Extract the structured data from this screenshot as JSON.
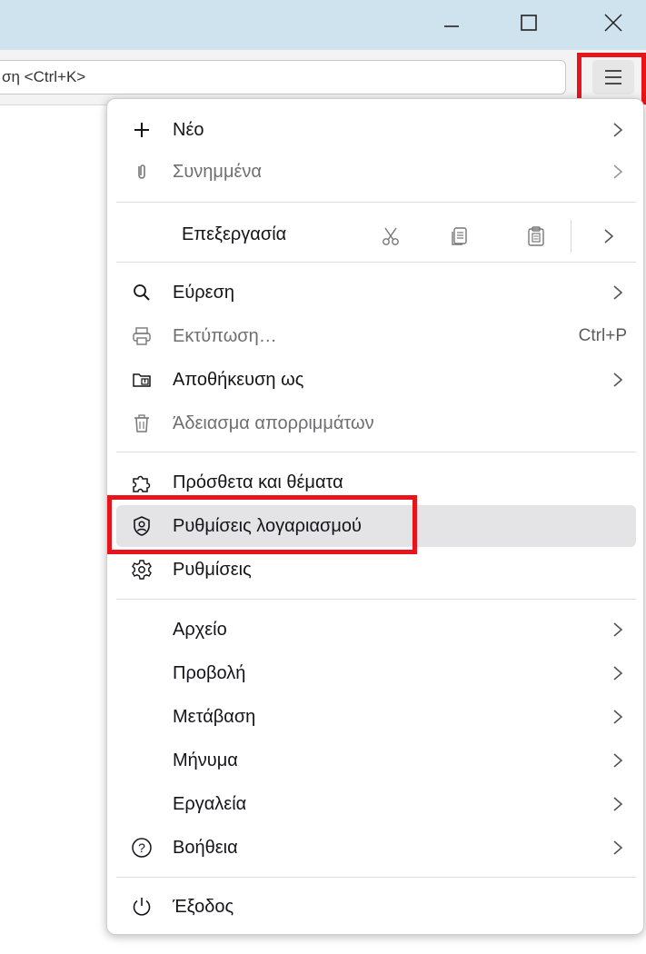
{
  "window": {
    "minimize_icon": "minimize-icon",
    "maximize_icon": "maximize-icon",
    "close_icon": "close-icon"
  },
  "search": {
    "placeholder_visible": "ση <Ctrl+K>"
  },
  "app_menu": {
    "button_icon": "hamburger-icon",
    "items_top": [
      {
        "label": "Νέο",
        "icon": "plus-icon",
        "submenu": true,
        "disabled": false
      },
      {
        "label": "Συνημμένα",
        "icon": "paperclip-icon",
        "submenu": true,
        "disabled": true
      }
    ],
    "edit": {
      "label": "Επεξεργασία",
      "cut_icon": "scissors-icon",
      "copy_icon": "copy-icon",
      "paste_icon": "paste-icon"
    },
    "items_mid": [
      {
        "label": "Εύρεση",
        "icon": "search-icon",
        "submenu": true,
        "disabled": false
      },
      {
        "label": "Εκτύπωση…",
        "icon": "printer-icon",
        "shortcut": "Ctrl+P",
        "disabled": true
      },
      {
        "label": "Αποθήκευση ως",
        "icon": "save-folder-icon",
        "submenu": true,
        "disabled": false
      },
      {
        "label": "Άδειασμα απορριμμάτων",
        "icon": "trash-icon",
        "disabled": true
      }
    ],
    "items_settings": [
      {
        "label": "Πρόσθετα και θέματα",
        "icon": "puzzle-icon"
      },
      {
        "label": "Ρυθμίσεις λογαριασμού",
        "icon": "account-shield-icon",
        "hovered": true
      },
      {
        "label": "Ρυθμίσεις",
        "icon": "gear-icon"
      }
    ],
    "items_submenus": [
      {
        "label": "Αρχείο"
      },
      {
        "label": "Προβολή"
      },
      {
        "label": "Μετάβαση"
      },
      {
        "label": "Μήνυμα"
      },
      {
        "label": "Εργαλεία"
      },
      {
        "label": "Βοήθεια",
        "icon": "help-icon"
      }
    ],
    "quit": {
      "label": "Έξοδος",
      "icon": "power-icon"
    }
  },
  "annotation_color": "#e8141c",
  "titlebar_color": "#cfe3ee"
}
